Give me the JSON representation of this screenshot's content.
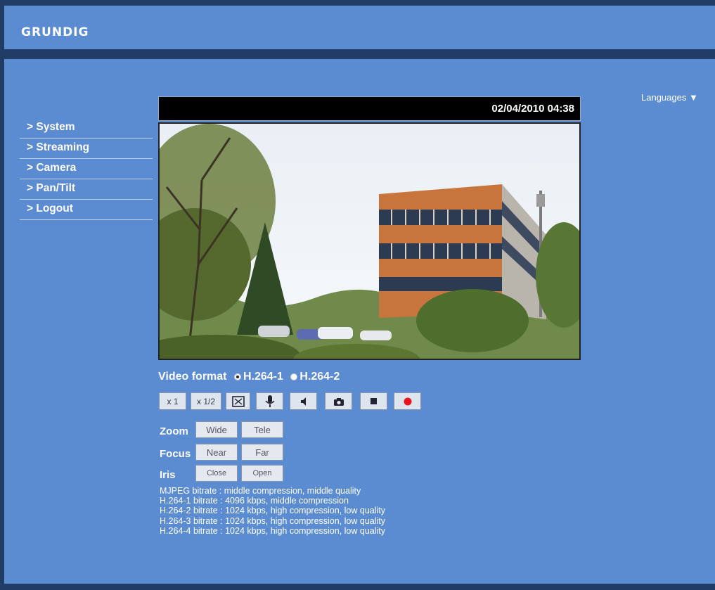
{
  "brand": "GRUNDIG",
  "languages_label": "Languages ▼",
  "menu": [
    {
      "label": "> System"
    },
    {
      "label": "> Streaming"
    },
    {
      "label": "> Camera"
    },
    {
      "label": "> Pan/Tilt"
    },
    {
      "label": "> Logout"
    }
  ],
  "timestamp": "02/04/2010 04:38",
  "video_format": {
    "label": "Video format",
    "options": [
      {
        "label": "H.264-1",
        "selected": true
      },
      {
        "label": "H.264-2",
        "selected": false
      }
    ]
  },
  "toolbar": {
    "x1": "x 1",
    "x12": "x 1/2",
    "icons": [
      "fullscreen-icon",
      "microphone-icon",
      "speaker-icon",
      "snapshot-icon",
      "stop-icon",
      "record-icon"
    ],
    "record_color": "#e8141e"
  },
  "controls": {
    "zoom": {
      "label": "Zoom",
      "wide": "Wide",
      "tele": "Tele"
    },
    "focus": {
      "label": "Focus",
      "near": "Near",
      "far": "Far"
    },
    "iris": {
      "label": "Iris",
      "close": "Close",
      "open": "Open"
    }
  },
  "bitrates": [
    "MJPEG bitrate : middle compression, middle quality",
    "H.264-1 bitrate : 4096 kbps, middle compression",
    "H.264-2 bitrate : 1024 kbps, high compression, low quality",
    "H.264-3 bitrate : 1024 kbps, high compression, low quality",
    "H.264-4 bitrate : 1024 kbps, high compression, low quality"
  ],
  "colors": {
    "background": "#5b8bd0",
    "frame": "#1f3d66"
  }
}
